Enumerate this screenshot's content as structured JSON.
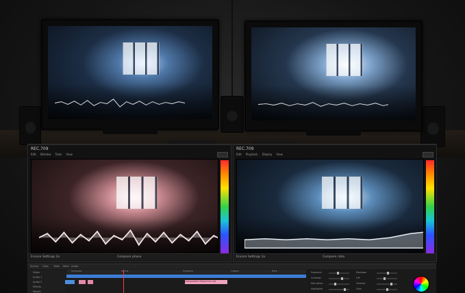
{
  "panels": {
    "left": {
      "title": "REC.709",
      "menu": [
        "Edit",
        "Window",
        "Tools",
        "View"
      ],
      "button": "",
      "footer_left": "Encore Settings 2x",
      "footer_center": "Compare phase"
    },
    "right": {
      "title": "REC.709",
      "menu": [
        "Edit",
        "Playback",
        "Display",
        "View"
      ],
      "button": "",
      "footer_left": "Encore Settings 3x",
      "footer_center": "Compare ratio"
    }
  },
  "timeline": {
    "header": [
      "Source",
      "Clips",
      "Tools",
      "Mark",
      "Audio"
    ],
    "tracks": [
      "Video",
      "Audio 1",
      "Audio 2",
      "Effects",
      "Master"
    ],
    "ruler": [
      "Timecode",
      "In Out",
      "Playback",
      "Output",
      "Rate"
    ],
    "clip_label": "Interpolated Sequence out",
    "controls": [
      "Exposure",
      "Contrast",
      "Saturation",
      "Highlights",
      "Shadows",
      "Lift",
      "Gamma",
      "Gain"
    ]
  },
  "colors": {
    "scope_top": "#ff2a2a",
    "scope_bottom": "#8a2be2",
    "clip_blue": "#3c7dd4",
    "clip_pink": "#f0a4bd",
    "playhead": "#ff3b3b"
  }
}
